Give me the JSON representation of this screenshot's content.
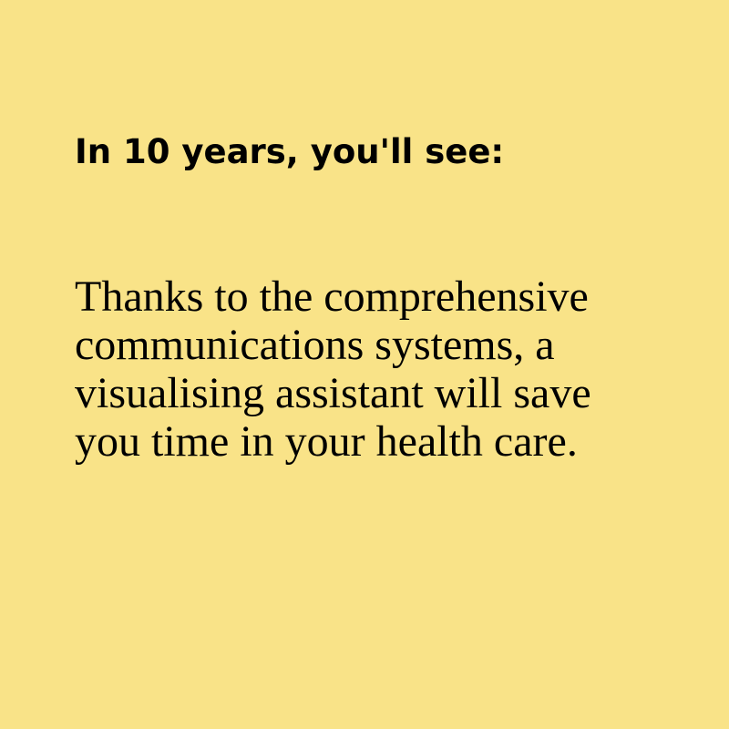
{
  "heading": "In 10 years, you'll see:",
  "body": "Thanks to the comprehensive communications systems, a visualising assistant will save you time in your health care.",
  "colors": {
    "background": "#f9e388",
    "text": "#000000"
  }
}
